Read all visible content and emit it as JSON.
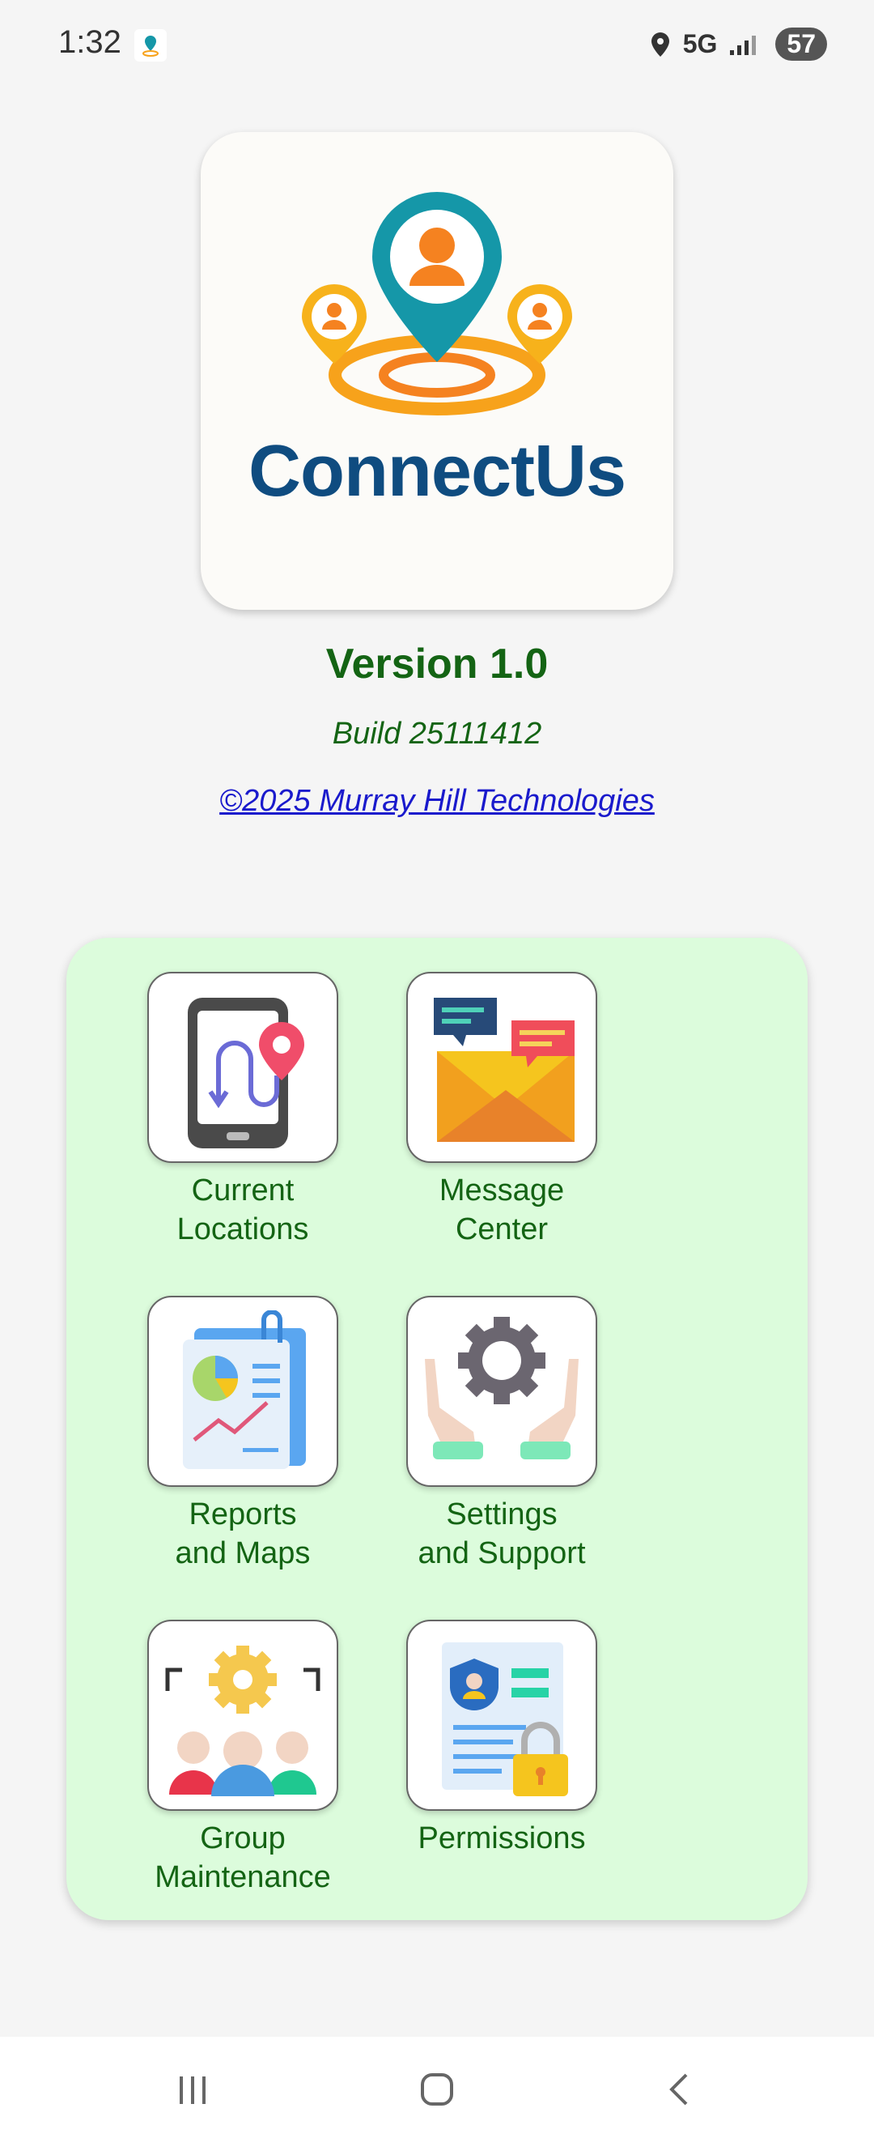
{
  "status_bar": {
    "time": "1:32",
    "network": "5G",
    "battery": "57"
  },
  "logo": {
    "wordmark": "ConnectUs"
  },
  "about": {
    "version": "Version 1.0",
    "build": "Build 25111412",
    "copyright": "©2025 Murray Hill Technologies"
  },
  "menu": {
    "items": [
      {
        "label": "Current\nLocations",
        "icon": "phone-route-icon"
      },
      {
        "label": "Message\nCenter",
        "icon": "envelope-chat-icon"
      },
      {
        "label": "Reports\nand Maps",
        "icon": "report-chart-icon"
      },
      {
        "label": "Settings\nand Support",
        "icon": "gear-hands-icon"
      },
      {
        "label": "Group\nMaintenance",
        "icon": "group-gear-icon"
      },
      {
        "label": "Permissions",
        "icon": "id-lock-icon"
      }
    ]
  },
  "nav": {
    "recents": "recents-icon",
    "home": "home-icon",
    "back": "back-icon"
  },
  "colors": {
    "accent_green": "#146414",
    "panel_bg": "#dcfcdc",
    "link_blue": "#1a1acc",
    "brand_blue": "#0f4c80",
    "brand_teal": "#1597a8",
    "brand_orange": "#f7a21b"
  }
}
